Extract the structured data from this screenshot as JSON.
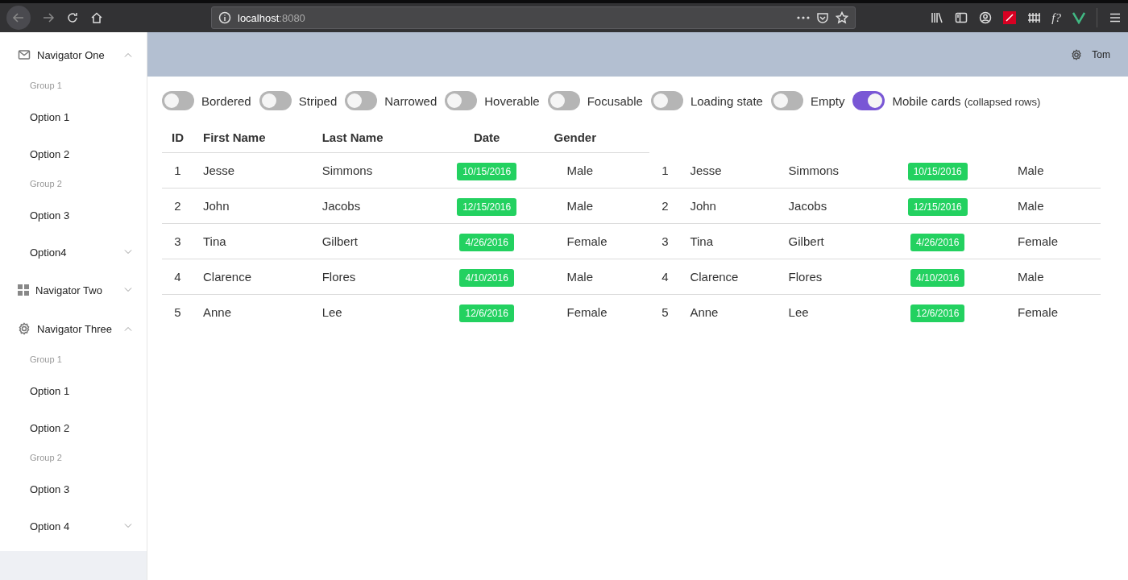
{
  "browser": {
    "address_host": "localhost",
    "address_port": ":8080",
    "toolbar_text": "f?"
  },
  "sidebar": {
    "navigators": [
      {
        "label": "Navigator One",
        "expanded": true,
        "groups": [
          {
            "label": "Group 1",
            "items": [
              {
                "label": "Option 1",
                "kind": "option"
              },
              {
                "label": "Option 2",
                "kind": "option"
              }
            ]
          },
          {
            "label": "Group 2",
            "items": [
              {
                "label": "Option 3",
                "kind": "option"
              },
              {
                "label": "Option4",
                "kind": "submenu",
                "expanded": false
              }
            ]
          }
        ]
      },
      {
        "label": "Navigator Two",
        "expanded": false
      },
      {
        "label": "Navigator Three",
        "expanded": true,
        "groups": [
          {
            "label": "Group 1",
            "items": [
              {
                "label": "Option 1",
                "kind": "option"
              },
              {
                "label": "Option 2",
                "kind": "option"
              }
            ]
          },
          {
            "label": "Group 2",
            "items": [
              {
                "label": "Option 3",
                "kind": "option"
              },
              {
                "label": "Option 4",
                "kind": "submenu",
                "expanded": false
              }
            ]
          }
        ]
      }
    ]
  },
  "header": {
    "user": "Tom"
  },
  "toggles": [
    {
      "label": "Bordered",
      "on": false
    },
    {
      "label": "Striped",
      "on": false
    },
    {
      "label": "Narrowed",
      "on": false
    },
    {
      "label": "Hoverable",
      "on": false
    },
    {
      "label": "Focusable",
      "on": false
    },
    {
      "label": "Loading state",
      "on": false
    },
    {
      "label": "Empty",
      "on": false
    },
    {
      "label": "Mobile cards",
      "note": "(collapsed rows)",
      "on": true
    }
  ],
  "table": {
    "columns": [
      "ID",
      "First Name",
      "Last Name",
      "Date",
      "Gender"
    ],
    "rows": [
      {
        "cells": [
          "1",
          "Jesse",
          "Simmons",
          "10/15/2016",
          "Male"
        ],
        "card_cells": [
          "1",
          "Jesse",
          "Simmons",
          "10/15/2016",
          "Male"
        ]
      },
      {
        "cells": [
          "2",
          "John",
          "Jacobs",
          "12/15/2016",
          "Male"
        ],
        "card_cells": [
          "2",
          "John",
          "Jacobs",
          "12/15/2016",
          "Male"
        ]
      },
      {
        "cells": [
          "3",
          "Tina",
          "Gilbert",
          "4/26/2016",
          "Female"
        ],
        "card_cells": [
          "3",
          "Tina",
          "Gilbert",
          "4/26/2016",
          "Female"
        ]
      },
      {
        "cells": [
          "4",
          "Clarence",
          "Flores",
          "4/10/2016",
          "Male"
        ],
        "card_cells": [
          "4",
          "Clarence",
          "Flores",
          "4/10/2016",
          "Male"
        ]
      },
      {
        "cells": [
          "5",
          "Anne",
          "Lee",
          "12/6/2016",
          "Female"
        ],
        "card_cells": [
          "5",
          "Anne",
          "Lee",
          "12/6/2016",
          "Female"
        ]
      }
    ]
  }
}
